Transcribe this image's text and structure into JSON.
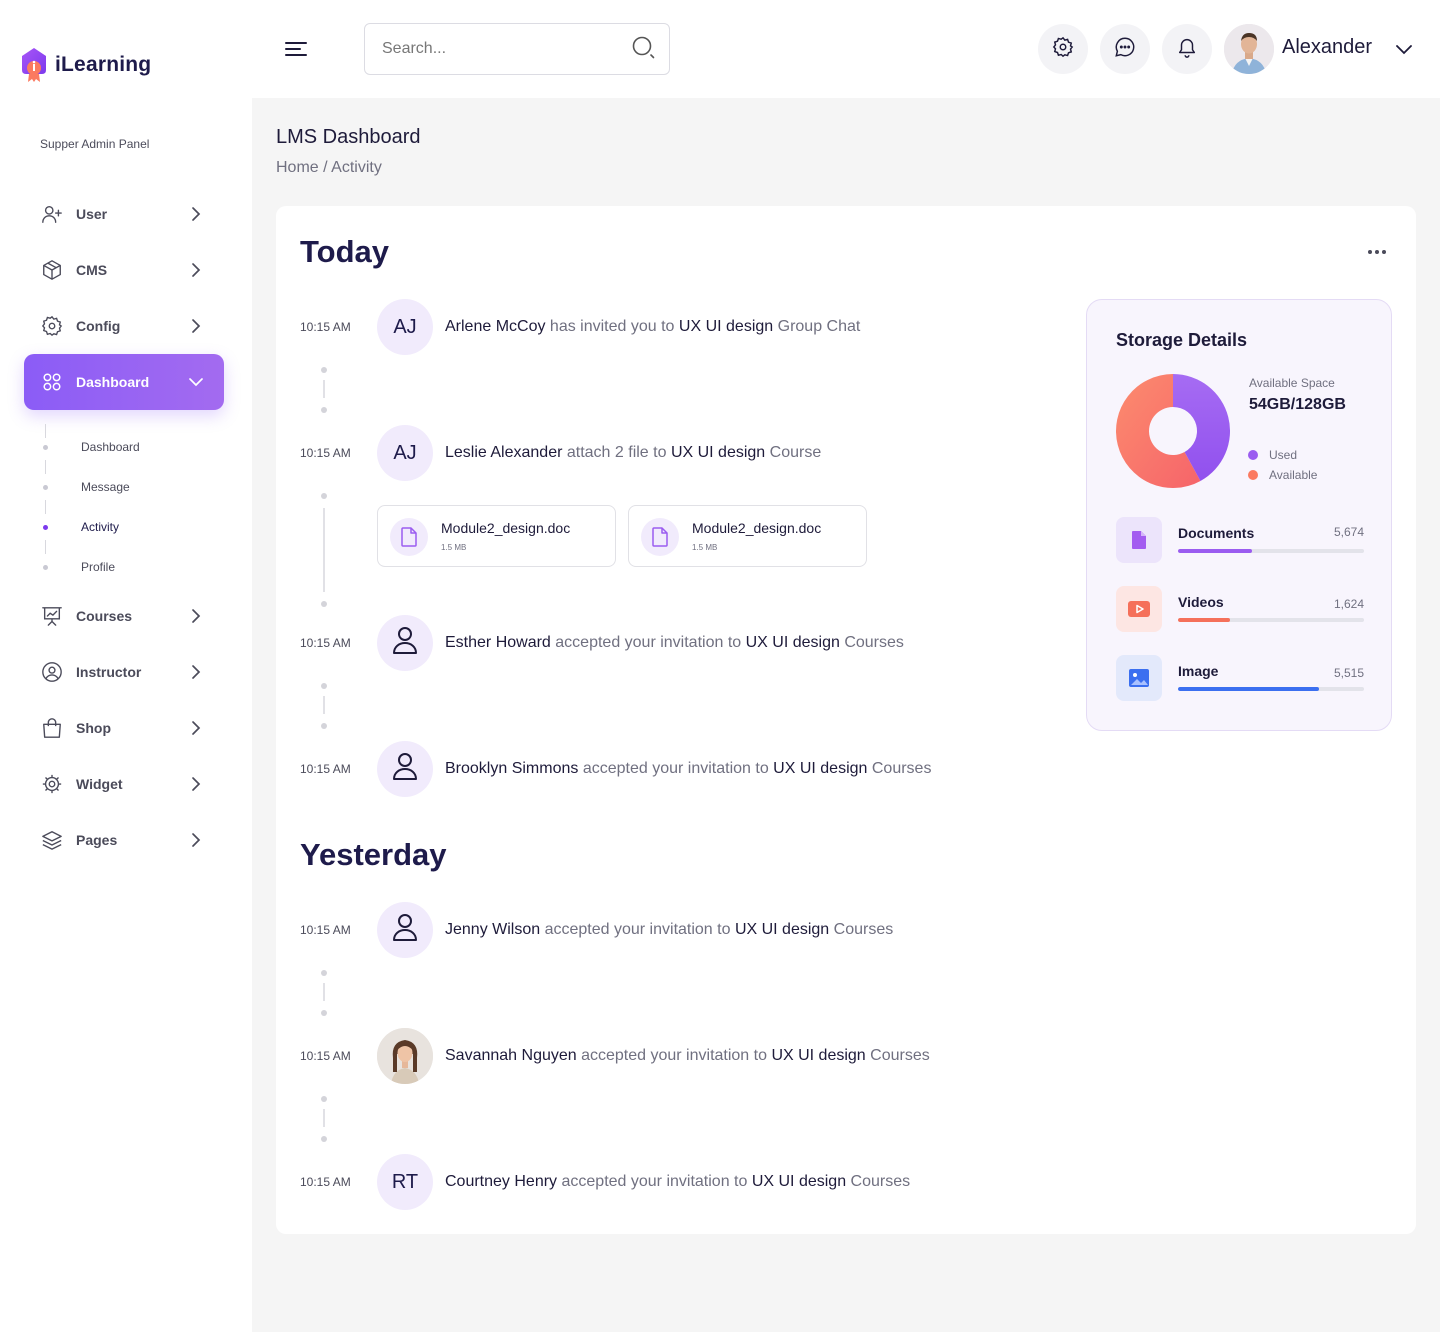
{
  "app": {
    "name": "iLearning",
    "panel_label": "Supper Admin Panel"
  },
  "sidebar": {
    "items": [
      {
        "label": "User",
        "icon": "user-plus-icon"
      },
      {
        "label": "CMS",
        "icon": "box-icon"
      },
      {
        "label": "Config",
        "icon": "gear-icon"
      },
      {
        "label": "Dashboard",
        "icon": "grid-icon",
        "active": true
      },
      {
        "label": "Courses",
        "icon": "presentation-chart-icon"
      },
      {
        "label": "Instructor",
        "icon": "user-circle-icon"
      },
      {
        "label": "Shop",
        "icon": "shopping-bag-icon"
      },
      {
        "label": "Widget",
        "icon": "cog-widget-icon"
      },
      {
        "label": "Pages",
        "icon": "layers-icon"
      }
    ],
    "sub_items": [
      {
        "label": "Dashboard"
      },
      {
        "label": "Message"
      },
      {
        "label": "Activity",
        "active": true
      },
      {
        "label": "Profile"
      }
    ]
  },
  "header": {
    "search_placeholder": "Search...",
    "user_name": "Alexander"
  },
  "page": {
    "title": "LMS Dashboard",
    "breadcrumb": {
      "home": "Home",
      "separator": " / ",
      "current": "Activity"
    }
  },
  "activity": {
    "today_title": "Today",
    "yesterday_title": "Yesterday",
    "today": [
      {
        "time": "10:15 AM",
        "avatar": "AJ",
        "name": "Arlene McCoy",
        "action": " has invited you to ",
        "target": "UX UI design",
        "suffix": " Group Chat"
      },
      {
        "time": "10:15 AM",
        "avatar": "AJ",
        "name": "Leslie Alexander",
        "action": " attach 2 file to ",
        "target": "UX UI design",
        "suffix": " Course"
      },
      {
        "time": "10:15 AM",
        "avatar": "",
        "name": "Esther Howard",
        "action": " accepted your invitation to ",
        "target": "UX UI design",
        "suffix": " Courses"
      },
      {
        "time": "10:15 AM",
        "avatar": "",
        "name": "Brooklyn Simmons",
        "action": " accepted your invitation to ",
        "target": "UX UI design",
        "suffix": " Courses"
      }
    ],
    "files": [
      {
        "name": "Module2_design.doc",
        "size": "1.5 MB"
      },
      {
        "name": "Module2_design.doc",
        "size": "1.5 MB"
      }
    ],
    "yesterday": [
      {
        "time": "10:15 AM",
        "avatar": "",
        "name": "Jenny Wilson",
        "action": " accepted your invitation to ",
        "target": "UX UI design",
        "suffix": " Courses"
      },
      {
        "time": "10:15 AM",
        "avatar": "",
        "name": "Savannah Nguyen",
        "action": " accepted your invitation to ",
        "target": "UX UI design",
        "suffix": " Courses"
      },
      {
        "time": "10:15 AM",
        "avatar": "RT",
        "name": "Courtney Henry",
        "action": " accepted your invitation to ",
        "target": "UX UI design",
        "suffix": " Courses"
      }
    ]
  },
  "storage": {
    "title": "Storage Details",
    "available_label": "Available Space",
    "available_value": "54GB/128GB",
    "legend": {
      "used": "Used",
      "available": "Available"
    },
    "used_fraction": 0.42,
    "colors": {
      "used": "#9b5cf0",
      "available": "#fb7a60"
    },
    "rows": [
      {
        "label": "Documents",
        "count": "5,674",
        "progress": 0.4,
        "color": "#9b5cf0",
        "icon": "document-icon"
      },
      {
        "label": "Videos",
        "count": "1,624",
        "progress": 0.28,
        "color": "#f5705a",
        "icon": "video-play-icon"
      },
      {
        "label": "Image",
        "count": "5,515",
        "progress": 0.76,
        "color": "#3b6ff0",
        "icon": "image-icon"
      }
    ]
  }
}
